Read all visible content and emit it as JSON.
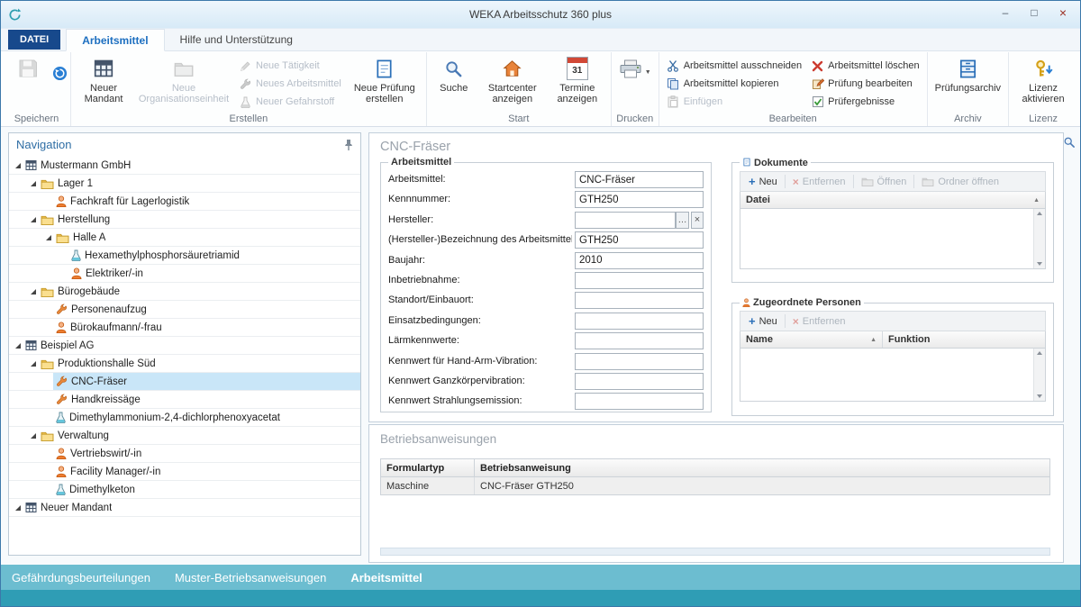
{
  "window": {
    "title": "WEKA Arbeitsschutz 360 plus",
    "controls": {
      "minimize": "–",
      "maximize": "□",
      "close": "×"
    }
  },
  "tabs": {
    "file": "DATEI",
    "items": [
      "Arbeitsmittel",
      "Hilfe und Unterstützung"
    ]
  },
  "ribbon": {
    "groups": {
      "speichern": "Speichern",
      "erstellen": "Erstellen",
      "start": "Start",
      "drucken": "Drucken",
      "bearbeiten": "Bearbeiten",
      "archiv": "Archiv",
      "lizenz": "Lizenz"
    },
    "buttons": {
      "neuer_mandant": "Neuer Mandant",
      "neue_organisationseinheit": "Neue Organisationseinheit",
      "neue_taetigkeit": "Neue Tätigkeit",
      "neues_arbeitsmittel": "Neues Arbeitsmittel",
      "neuer_gefahrstoff": "Neuer Gefahrstoff",
      "neue_pruefung_erstellen": "Neue Prüfung erstellen",
      "suche": "Suche",
      "startcenter_anzeigen": "Startcenter anzeigen",
      "termine_anzeigen": "Termine anzeigen",
      "arbeitsmittel_ausschneiden": "Arbeitsmittel ausschneiden",
      "arbeitsmittel_kopieren": "Arbeitsmittel kopieren",
      "einfuegen": "Einfügen",
      "arbeitsmittel_loeschen": "Arbeitsmittel löschen",
      "pruefung_bearbeiten": "Prüfung bearbeiten",
      "pruefergebnisse": "Prüfergebnisse",
      "pruefungsarchiv": "Prüfungsarchiv",
      "lizenz_aktivieren": "Lizenz aktivieren"
    },
    "calendar_day": "31",
    "dropdown": "▼"
  },
  "navigation": {
    "title": "Navigation",
    "items": [
      "Mustermann GmbH",
      "Lager 1",
      "Fachkraft für Lagerlogistik",
      "Herstellung",
      "Halle A",
      "Hexamethylphosphorsäuretriamid",
      "Elektriker/-in",
      "Bürogebäude",
      "Personenaufzug",
      "Bürokaufmann/-frau",
      "Beispiel AG",
      "Produktionshalle Süd",
      "CNC-Fräser",
      "Handkreissäge",
      "Dimethylammonium-2,4-dichlorphenoxyacetat",
      "Verwaltung",
      "Vertriebswirt/-in",
      "Facility Manager/-in",
      "Dimethylketon",
      "Neuer Mandant"
    ],
    "selected_item": "CNC-Fräser"
  },
  "main": {
    "title": "CNC-Fräser",
    "arbeitsmittel": {
      "legend": "Arbeitsmittel",
      "fields": [
        {
          "label": "Arbeitsmittel:",
          "value": "CNC-Fräser"
        },
        {
          "label": "Kennnummer:",
          "value": "GTH250"
        },
        {
          "label": "Hersteller:",
          "value": ""
        },
        {
          "label": "(Hersteller-)Bezeichnung des Arbeitsmittels:",
          "value": "GTH250"
        },
        {
          "label": "Baujahr:",
          "value": "2010"
        },
        {
          "label": "Inbetriebnahme:",
          "value": ""
        },
        {
          "label": "Standort/Einbauort:",
          "value": ""
        },
        {
          "label": "Einsatzbedingungen:",
          "value": ""
        },
        {
          "label": "Lärmkennwerte:",
          "value": ""
        },
        {
          "label": "Kennwert für Hand-Arm-Vibration:",
          "value": ""
        },
        {
          "label": "Kennwert Ganzkörpervibration:",
          "value": ""
        },
        {
          "label": "Kennwert Strahlungsemission:",
          "value": ""
        }
      ]
    },
    "dokumente": {
      "legend": "Dokumente",
      "buttons": [
        "Neu",
        "Entfernen",
        "Öffnen",
        "Ordner öffnen"
      ],
      "column": "Datei"
    },
    "personen": {
      "legend": "Zugeordnete Personen",
      "buttons": [
        "Neu",
        "Entfernen"
      ],
      "columns": [
        "Name",
        "Funktion"
      ]
    },
    "betriebsanweisungen": {
      "title": "Betriebsanweisungen",
      "columns": [
        "Formulartyp",
        "Betriebsanweisung"
      ],
      "rows": [
        {
          "formulartyp": "Maschine",
          "betriebsanweisung": "CNC-Fräser GTH250"
        }
      ]
    }
  },
  "footer": {
    "items": [
      "Gefährdungsbeurteilungen",
      "Muster-Betriebsanweisungen",
      "Arbeitsmittel"
    ],
    "active": "Arbeitsmittel"
  },
  "glyphs": {
    "plus": "+",
    "cross": "×",
    "ellipsis": "…",
    "sort_asc": "▲"
  },
  "colors": {
    "accent_blue": "#1d6fc0",
    "datei_bg": "#17498c",
    "tree_selection": "#c9e6f8",
    "footer_bg": "#6cbdd0",
    "footer_strip": "#2f9db5",
    "disabled_text": "#b6bec8"
  }
}
